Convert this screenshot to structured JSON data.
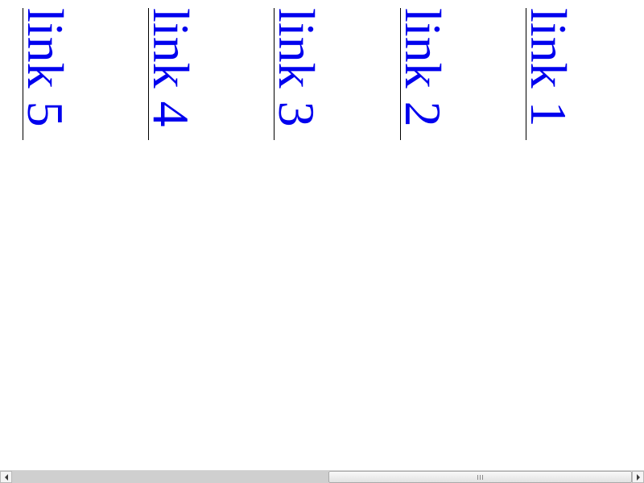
{
  "links": [
    {
      "label": "link 5"
    },
    {
      "label": "link 4"
    },
    {
      "label": "link 3"
    },
    {
      "label": "link 2"
    },
    {
      "label": "link 1"
    }
  ],
  "colors": {
    "link": "#0000ee",
    "rule": "#000000",
    "background": "#ffffff"
  },
  "scrollbar": {
    "horizontal_position_fraction": 0.0,
    "visible_fraction": 0.51
  }
}
